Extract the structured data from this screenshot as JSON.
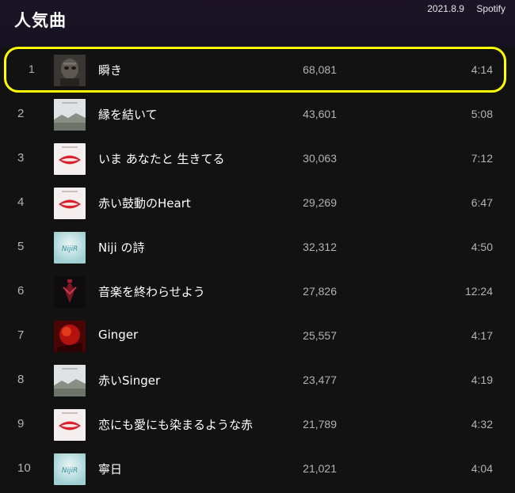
{
  "header": {
    "title": "人気曲",
    "date": "2021.8.9",
    "service": "Spotify"
  },
  "colors": {
    "background": "#121212",
    "highlight": "#ffff00",
    "text_secondary": "#b3b3b3"
  },
  "tracks": [
    {
      "rank": "1",
      "title": "瞬き",
      "plays": "68,081",
      "duration": "4:14",
      "cover": "dark-portrait"
    },
    {
      "rank": "2",
      "title": "縁を結いて",
      "plays": "43,601",
      "duration": "5:08",
      "cover": "landscape"
    },
    {
      "rank": "3",
      "title": "いま あなたと 生きてる",
      "plays": "30,063",
      "duration": "7:12",
      "cover": "red-lips"
    },
    {
      "rank": "4",
      "title": "赤い鼓動のHeart",
      "plays": "29,269",
      "duration": "6:47",
      "cover": "red-lips"
    },
    {
      "rank": "5",
      "title": "Niji の詩",
      "plays": "32,312",
      "duration": "4:50",
      "cover": "niji-teal"
    },
    {
      "rank": "6",
      "title": "音楽を終わらせよう",
      "plays": "27,826",
      "duration": "12:24",
      "cover": "dark-red-figure"
    },
    {
      "rank": "7",
      "title": "Ginger",
      "plays": "25,557",
      "duration": "4:17",
      "cover": "red-abstract"
    },
    {
      "rank": "8",
      "title": "赤いSinger",
      "plays": "23,477",
      "duration": "4:19",
      "cover": "landscape"
    },
    {
      "rank": "9",
      "title": "恋にも愛にも染まるような赤",
      "plays": "21,789",
      "duration": "4:32",
      "cover": "red-lips"
    },
    {
      "rank": "10",
      "title": "寧日",
      "plays": "21,021",
      "duration": "4:04",
      "cover": "niji-teal"
    }
  ]
}
